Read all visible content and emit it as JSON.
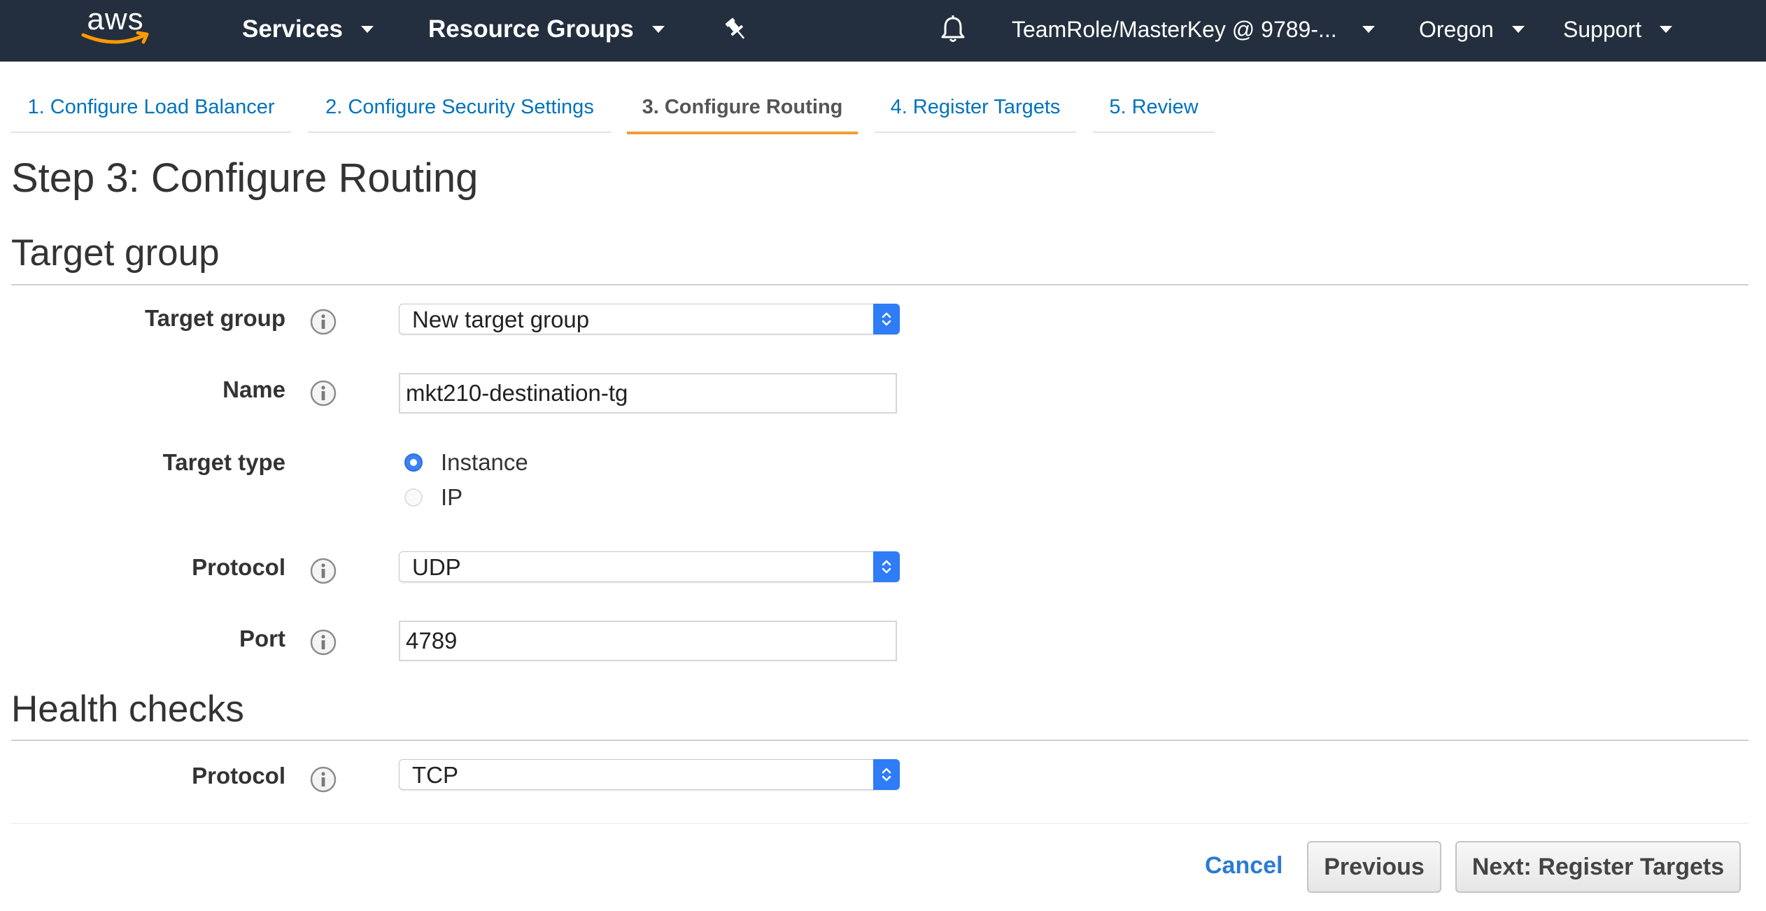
{
  "topnav": {
    "logo": "aws",
    "services": "Services",
    "resource_groups": "Resource Groups",
    "pin_icon": "pin-icon",
    "bell_icon": "bell-icon",
    "account": "TeamRole/MasterKey @ 9789-...",
    "region": "Oregon",
    "support": "Support"
  },
  "tabs": [
    {
      "label": "1. Configure Load Balancer",
      "active": false
    },
    {
      "label": "2. Configure Security Settings",
      "active": false
    },
    {
      "label": "3. Configure Routing",
      "active": true
    },
    {
      "label": "4. Register Targets",
      "active": false
    },
    {
      "label": "5. Review",
      "active": false
    }
  ],
  "page_title": "Step 3: Configure Routing",
  "target_group_section": {
    "heading": "Target group",
    "target_group_label": "Target group",
    "target_group_value": "New target group",
    "name_label": "Name",
    "name_value": "mkt210-destination-tg",
    "target_type_label": "Target type",
    "target_type_options": [
      {
        "label": "Instance",
        "selected": true
      },
      {
        "label": "IP",
        "selected": false
      }
    ],
    "protocol_label": "Protocol",
    "protocol_value": "UDP",
    "port_label": "Port",
    "port_value": "4789"
  },
  "health_checks_section": {
    "heading": "Health checks",
    "protocol_label": "Protocol",
    "protocol_value": "TCP"
  },
  "footer": {
    "cancel": "Cancel",
    "previous": "Previous",
    "next": "Next: Register Targets"
  },
  "colors": {
    "nav_bg": "#232f3e",
    "link": "#0073bb",
    "active_tab_underline": "#f29d38",
    "select_accent": "#2e7cf6",
    "aws_smile": "#ff9900"
  }
}
